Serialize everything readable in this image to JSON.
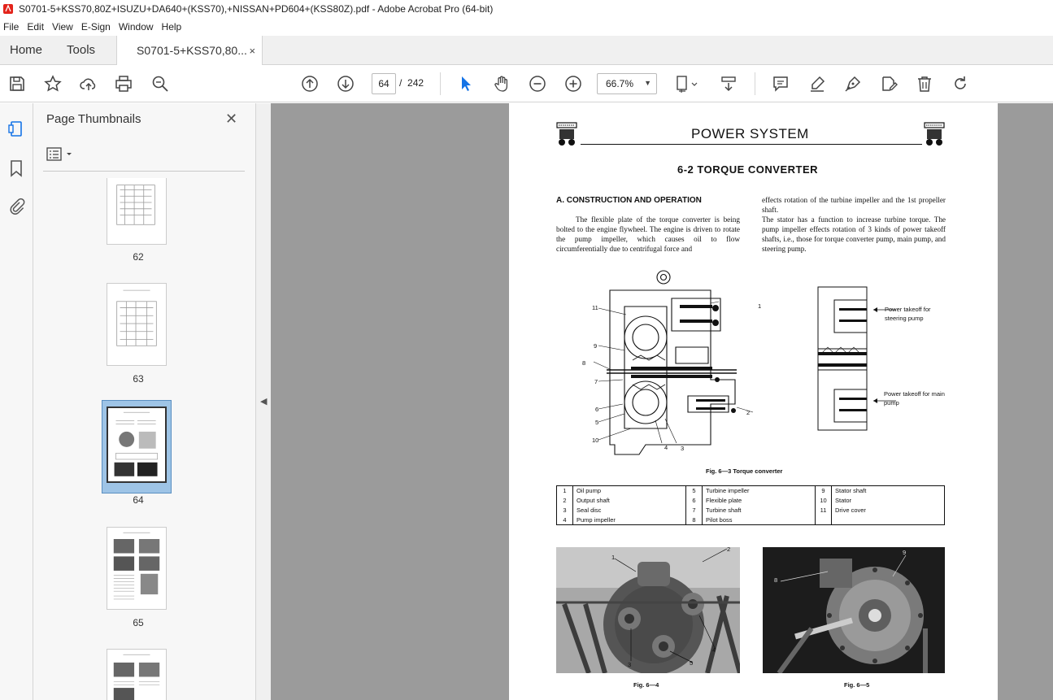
{
  "window": {
    "title": "S0701-5+KSS70,80Z+ISUZU+DA640+(KSS70),+NISSAN+PD604+(KSS80Z).pdf - Adobe Acrobat Pro (64-bit)"
  },
  "menu": [
    "File",
    "Edit",
    "View",
    "E-Sign",
    "Window",
    "Help"
  ],
  "tabs": {
    "home": "Home",
    "tools": "Tools",
    "document": "S0701-5+KSS70,80...",
    "close_glyph": "×"
  },
  "toolbar": {
    "current_page": "64",
    "page_separator": "/",
    "total_pages": "242",
    "zoom": "66.7%"
  },
  "panel": {
    "title": "Page Thumbnails",
    "close_glyph": "✕",
    "thumbnails": [
      {
        "label": "62",
        "selected": false
      },
      {
        "label": "63",
        "selected": false
      },
      {
        "label": "64",
        "selected": true
      },
      {
        "label": "65",
        "selected": false
      },
      {
        "label": "",
        "selected": false
      }
    ]
  },
  "page": {
    "header_title": "POWER SYSTEM",
    "section_title": "6-2   TORQUE CONVERTER",
    "subsection_title": "A.   CONSTRUCTION AND OPERATION",
    "para_left": "The flexible plate of the torque converter is being bolted to the engine flywheel. The engine is driven to rotate the pump impeller, which causes oil to flow circumferentially due to centrifugal force and",
    "para_right_1": "effects rotation of the turbine impeller and the 1st propeller shaft.",
    "para_right_2": "The stator has a function to increase turbine torque. The pump impeller effects rotation of 3 kinds of power takeoff shafts, i.e., those for torque converter pump, main pump, and steering pump.",
    "side_callout_1": "Power takeoff for steering pump",
    "side_callout_2": "Power takeoff for main pump",
    "fig_callouts": [
      "11",
      "9",
      "8",
      "7",
      "6",
      "5",
      "10",
      "4",
      "3",
      "2",
      "1"
    ],
    "fig_caption": "Fig. 6—3        Torque converter",
    "legend": [
      [
        "1",
        "Oil pump",
        "5",
        "Turbine impeller",
        "9",
        "Stator shaft"
      ],
      [
        "2",
        "Output shaft",
        "6",
        "Flexible plate",
        "10",
        "Stator"
      ],
      [
        "3",
        "Seal disc",
        "7",
        "Turbine shaft",
        "11",
        "Drive cover"
      ],
      [
        "4",
        "Pump impeller",
        "8",
        "Pilot boss",
        "",
        ""
      ]
    ],
    "photo1_callouts": [
      "1",
      "2",
      "3",
      "4",
      "5"
    ],
    "photo2_callouts": [
      "8",
      "9"
    ],
    "photo1_caption": "Fig. 6—4",
    "photo2_caption": "Fig. 6—5"
  }
}
